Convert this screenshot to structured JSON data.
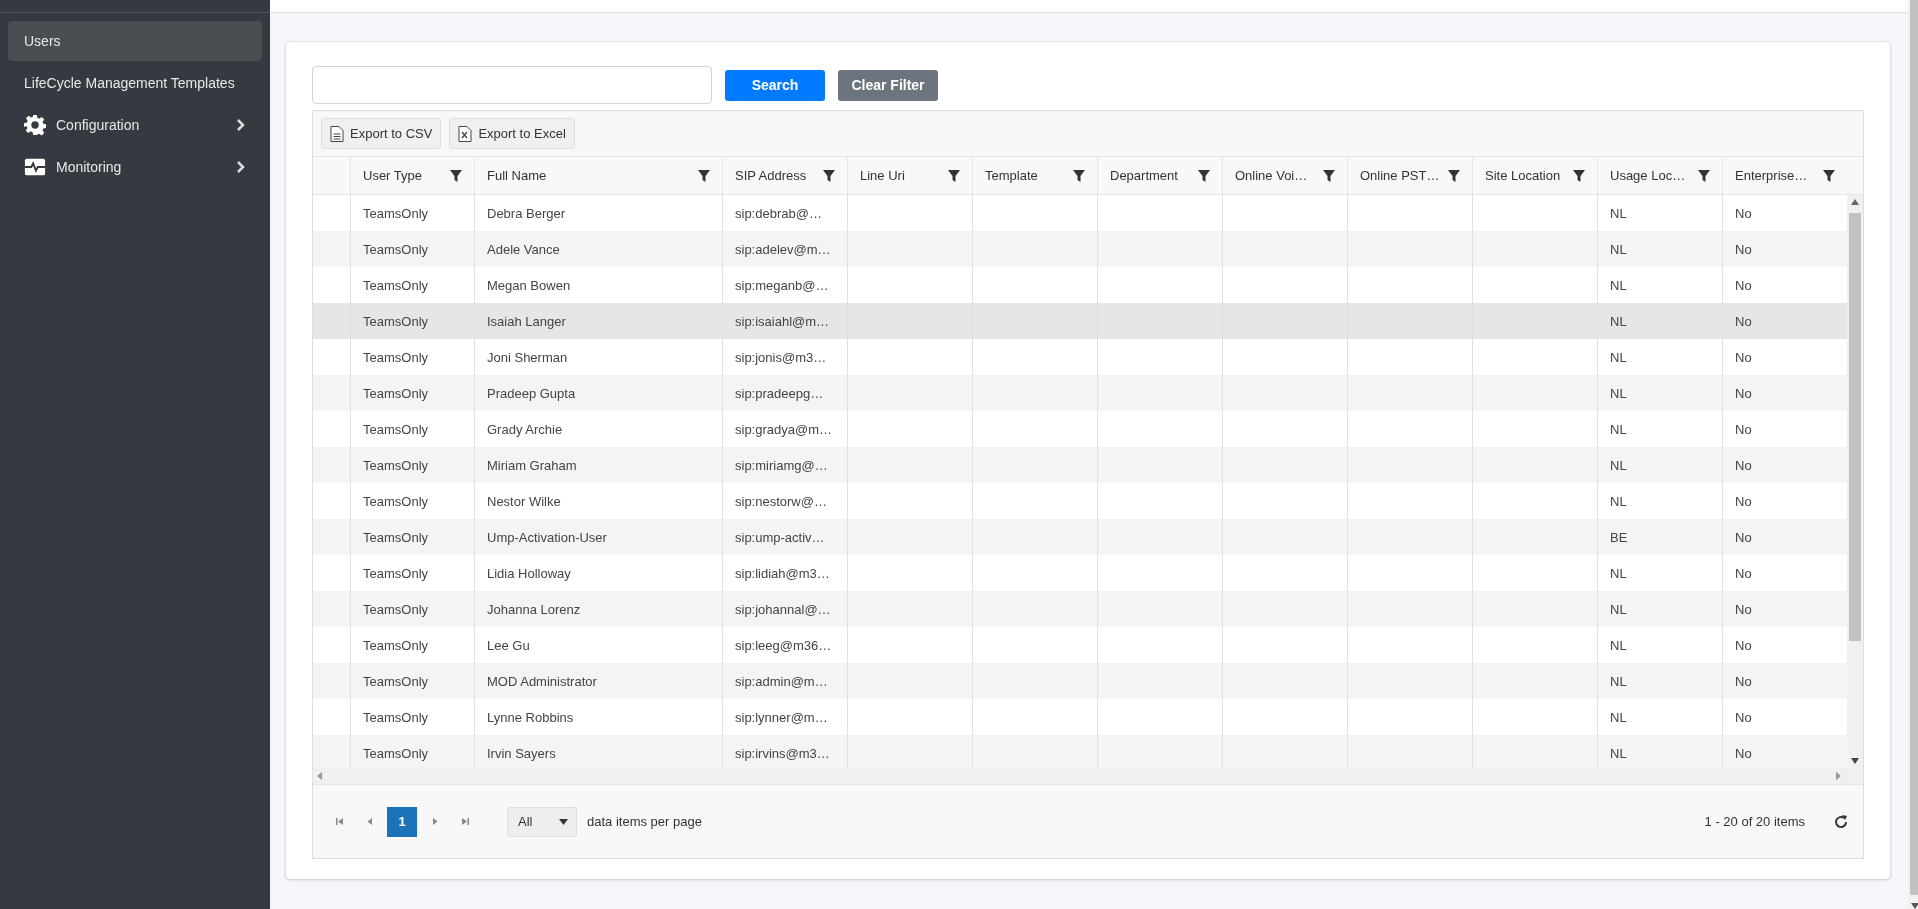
{
  "sidebar": {
    "items": [
      {
        "label": "Users",
        "submenu": false,
        "selected": true
      },
      {
        "label": "LifeCycle Management Templates",
        "submenu": false,
        "selected": false
      },
      {
        "label": "Configuration",
        "submenu": true,
        "selected": false
      },
      {
        "label": "Monitoring",
        "submenu": true,
        "selected": false
      }
    ]
  },
  "search": {
    "buttons": [
      {
        "label": "Search",
        "kind": "primary"
      },
      {
        "label": "Clear Filter",
        "kind": "secondary"
      }
    ]
  },
  "toolbar": [
    {
      "label": "Export to CSV",
      "kind": "csv"
    },
    {
      "label": "Export to Excel",
      "kind": "excel"
    }
  ],
  "table": {
    "columns": [
      "User Type",
      "Full Name",
      "SIP Address",
      "Line Uri",
      "Template",
      "Department",
      "Online Voi…",
      "Online PST…",
      "Site Location",
      "Usage Loc…",
      "Enterprise…"
    ],
    "rows": [
      {
        "user_type": "TeamsOnly",
        "full_name": "Debra Berger",
        "sip_address": "sip:debrab@…",
        "usage_location": "NL",
        "enterprise": "No",
        "selected": false
      },
      {
        "user_type": "TeamsOnly",
        "full_name": "Adele Vance",
        "sip_address": "sip:adelev@m…",
        "usage_location": "NL",
        "enterprise": "No",
        "selected": false
      },
      {
        "user_type": "TeamsOnly",
        "full_name": "Megan Bowen",
        "sip_address": "sip:meganb@…",
        "usage_location": "NL",
        "enterprise": "No",
        "selected": false
      },
      {
        "user_type": "TeamsOnly",
        "full_name": "Isaiah Langer",
        "sip_address": "sip:isaiahl@m…",
        "usage_location": "NL",
        "enterprise": "No",
        "selected": true
      },
      {
        "user_type": "TeamsOnly",
        "full_name": "Joni Sherman",
        "sip_address": "sip:jonis@m3…",
        "usage_location": "NL",
        "enterprise": "No",
        "selected": false
      },
      {
        "user_type": "TeamsOnly",
        "full_name": "Pradeep Gupta",
        "sip_address": "sip:pradeepg…",
        "usage_location": "NL",
        "enterprise": "No",
        "selected": false
      },
      {
        "user_type": "TeamsOnly",
        "full_name": "Grady Archie",
        "sip_address": "sip:gradya@m…",
        "usage_location": "NL",
        "enterprise": "No",
        "selected": false
      },
      {
        "user_type": "TeamsOnly",
        "full_name": "Miriam Graham",
        "sip_address": "sip:miriamg@…",
        "usage_location": "NL",
        "enterprise": "No",
        "selected": false
      },
      {
        "user_type": "TeamsOnly",
        "full_name": "Nestor Wilke",
        "sip_address": "sip:nestorw@…",
        "usage_location": "NL",
        "enterprise": "No",
        "selected": false
      },
      {
        "user_type": "TeamsOnly",
        "full_name": "Ump-Activation-User",
        "sip_address": "sip:ump-activ…",
        "usage_location": "BE",
        "enterprise": "No",
        "selected": false
      },
      {
        "user_type": "TeamsOnly",
        "full_name": "Lidia Holloway",
        "sip_address": "sip:lidiah@m3…",
        "usage_location": "NL",
        "enterprise": "No",
        "selected": false
      },
      {
        "user_type": "TeamsOnly",
        "full_name": "Johanna Lorenz",
        "sip_address": "sip:johannal@…",
        "usage_location": "NL",
        "enterprise": "No",
        "selected": false
      },
      {
        "user_type": "TeamsOnly",
        "full_name": "Lee Gu",
        "sip_address": "sip:leeg@m36…",
        "usage_location": "NL",
        "enterprise": "No",
        "selected": false
      },
      {
        "user_type": "TeamsOnly",
        "full_name": "MOD Administrator",
        "sip_address": "sip:admin@m…",
        "usage_location": "NL",
        "enterprise": "No",
        "selected": false
      },
      {
        "user_type": "TeamsOnly",
        "full_name": "Lynne Robbins",
        "sip_address": "sip:lynner@m…",
        "usage_location": "NL",
        "enterprise": "No",
        "selected": false
      },
      {
        "user_type": "TeamsOnly",
        "full_name": "Irvin Sayers",
        "sip_address": "sip:irvins@m3…",
        "usage_location": "NL",
        "enterprise": "No",
        "selected": false
      }
    ]
  },
  "pager": {
    "pages": [
      {
        "label": "1",
        "selected": true
      }
    ],
    "page_size": "All",
    "page_size_label": "data items per page",
    "summary": "1 - 20 of 20 items"
  }
}
